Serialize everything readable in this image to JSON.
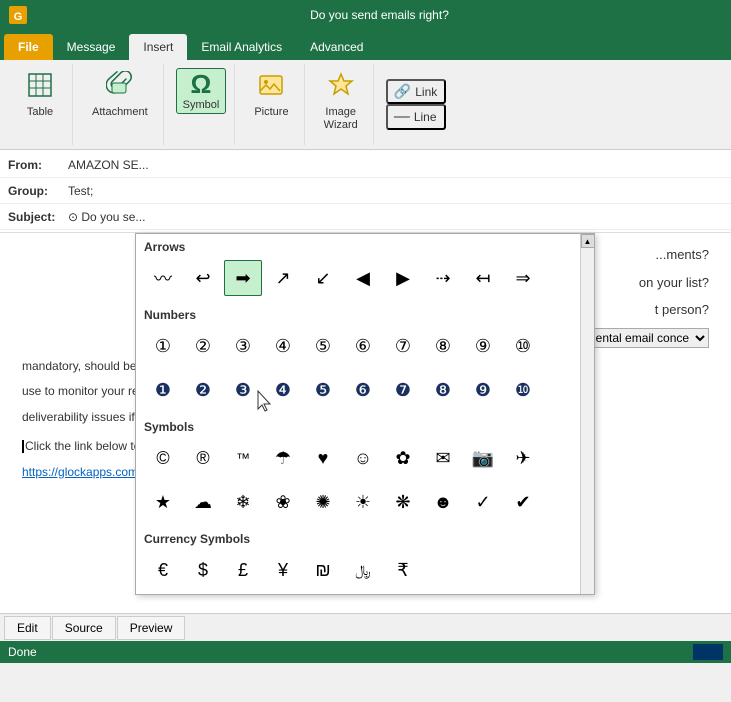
{
  "titleBar": {
    "title": "Do you send emails right?",
    "iconColor": "#1e7145"
  },
  "ribbonTabs": {
    "tabs": [
      {
        "id": "file",
        "label": "File",
        "type": "file"
      },
      {
        "id": "message",
        "label": "Message",
        "type": "normal"
      },
      {
        "id": "insert",
        "label": "Insert",
        "type": "active"
      },
      {
        "id": "email-analytics",
        "label": "Email Analytics",
        "type": "normal"
      },
      {
        "id": "advanced",
        "label": "Advanced",
        "type": "normal"
      }
    ]
  },
  "ribbon": {
    "groups": [
      {
        "id": "table",
        "buttons": [
          {
            "id": "table-btn",
            "label": "Table",
            "icon": "⊞"
          }
        ]
      },
      {
        "id": "attachment",
        "buttons": [
          {
            "id": "attachment-btn",
            "label": "Attachment",
            "icon": "📎"
          }
        ]
      },
      {
        "id": "symbol",
        "buttons": [
          {
            "id": "symbol-btn",
            "label": "Symbol",
            "icon": "Ω",
            "active": true
          }
        ]
      },
      {
        "id": "picture",
        "buttons": [
          {
            "id": "picture-btn",
            "label": "Picture",
            "icon": "🖼"
          }
        ]
      },
      {
        "id": "image-wizard",
        "buttons": [
          {
            "id": "image-wizard-btn",
            "label": "Image\nWizard",
            "icon": "✨"
          }
        ]
      },
      {
        "id": "link-line",
        "smallButtons": [
          {
            "id": "link-btn",
            "label": "Link",
            "icon": "🔗"
          },
          {
            "id": "line-btn",
            "label": "Line",
            "icon": "—"
          }
        ]
      }
    ]
  },
  "emailFields": {
    "from": {
      "label": "From:",
      "value": "AMAZON SE..."
    },
    "group": {
      "label": "Group:",
      "value": "Test;"
    },
    "subject": {
      "label": "Subject:",
      "value": "⊙ Do you se..."
    }
  },
  "symbolDropdown": {
    "sections": [
      {
        "id": "arrows",
        "title": "Arrows",
        "symbols": [
          "〰",
          "↩",
          "➡",
          "↗",
          "↙",
          "◀",
          "▶",
          "⇢",
          "↤",
          "⇒"
        ]
      },
      {
        "id": "numbers-outline",
        "title": "Numbers",
        "symbols": [
          "①",
          "②",
          "③",
          "④",
          "⑤",
          "⑥",
          "⑦",
          "⑧",
          "⑨",
          "⑩"
        ]
      },
      {
        "id": "numbers-filled",
        "title": "",
        "symbols": [
          "❶",
          "❷",
          "❸",
          "❹",
          "❺",
          "❻",
          "❼",
          "❽",
          "❾",
          "❿"
        ]
      },
      {
        "id": "symbols",
        "title": "Symbols",
        "symbols": [
          "©",
          "®",
          "™",
          "☂",
          "♥",
          "☺",
          "✿",
          "✉",
          "📷",
          "✈"
        ]
      },
      {
        "id": "symbols2",
        "title": "",
        "symbols": [
          "★",
          "☁",
          "❄",
          "❀",
          "✺",
          "☀",
          "❋",
          "☻",
          "✓",
          "✔"
        ]
      },
      {
        "id": "currency",
        "title": "Currency Symbols",
        "symbols": [
          "€",
          "$",
          "£",
          "¥",
          "₪",
          "﷼",
          "₹"
        ]
      }
    ]
  },
  "emailBody": {
    "text1": "...ments?",
    "text2": "on your list?",
    "text3": "t person?",
    "text4": "nmental email conce",
    "text5": "mandatory, should be aware of. F... good and bad sending",
    "text6": "use to monitor your reputation and deliverability and deter",
    "text7": "deliverability issues if they happen.",
    "text8": "Click the link below to read the article:",
    "link": "https://glockapps.com/blog/email-delivery-basics/"
  },
  "bottomTabs": [
    {
      "id": "edit",
      "label": "Edit"
    },
    {
      "id": "source",
      "label": "Source",
      "active": false
    },
    {
      "id": "preview",
      "label": "Preview"
    }
  ],
  "statusBar": {
    "text": "Done"
  },
  "colors": {
    "accent": "#1e7145",
    "link": "#0563C1",
    "fileTab": "#e8a000"
  }
}
